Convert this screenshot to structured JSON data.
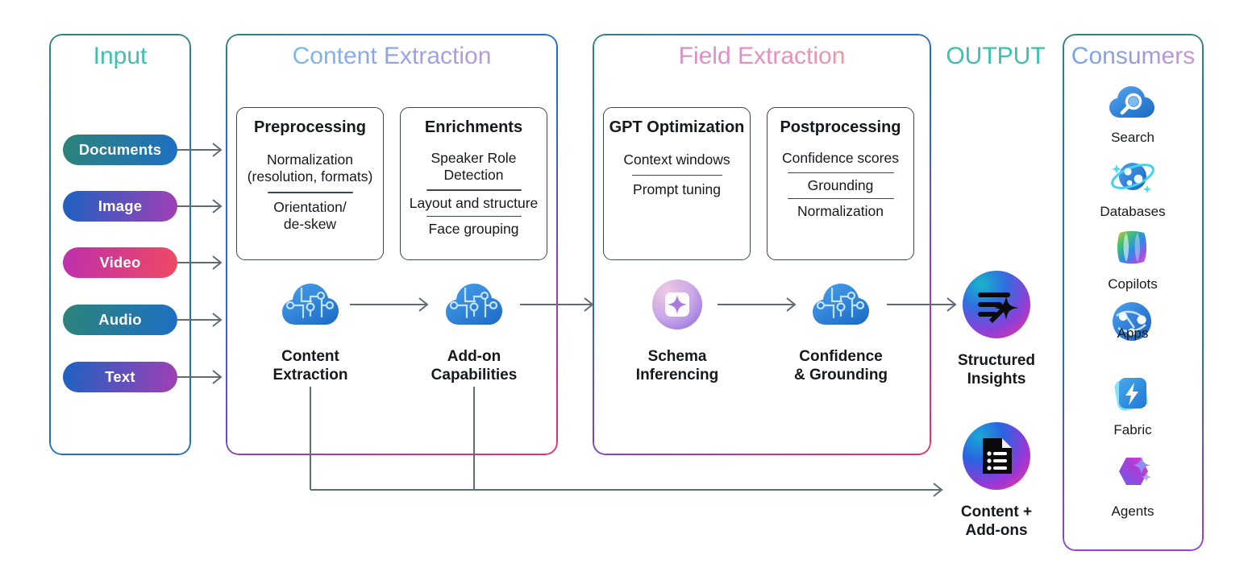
{
  "diagram": {
    "title": "Content Understanding pipeline architecture",
    "sections": {
      "input": {
        "title": "Input",
        "color": "#3fbfb0"
      },
      "content_extraction": {
        "title": "Content Extraction"
      },
      "field_extraction": {
        "title": "Field Extraction"
      },
      "output": {
        "title": "OUTPUT",
        "color": "#3fbfb0"
      },
      "consumers": {
        "title": "Consumers"
      }
    },
    "input_items": [
      {
        "label": "Documents",
        "from": "#2d8479",
        "to": "#1e6fc4"
      },
      {
        "label": "Image",
        "from": "#1b62c2",
        "to": "#a23fb5"
      },
      {
        "label": "Video",
        "from": "#bd2fad",
        "to": "#ef4a62"
      },
      {
        "label": "Audio",
        "from": "#2d8479",
        "to": "#1e6fc4"
      },
      {
        "label": "Text",
        "from": "#1b62c2",
        "to": "#a23fb5"
      }
    ],
    "content_extraction_cards": [
      {
        "heading": "Preprocessing",
        "rows": [
          "Normalization\n(resolution, formats)",
          "Orientation/\nde-skew"
        ]
      },
      {
        "heading": "Enrichments",
        "rows": [
          "Speaker Role\nDetection",
          "Layout and structure",
          "Face grouping"
        ]
      }
    ],
    "field_extraction_cards": [
      {
        "heading": "GPT Optimization",
        "rows": [
          "Context windows",
          "Prompt tuning"
        ]
      },
      {
        "heading": "Postprocessing",
        "rows": [
          "Confidence scores",
          "Grounding",
          "Normalization"
        ]
      }
    ],
    "content_extraction_nodes": [
      {
        "label": "Content\nExtraction",
        "icon": "cloud-circuit-icon"
      },
      {
        "label": "Add-on\nCapabilities",
        "icon": "cloud-circuit-icon"
      }
    ],
    "field_extraction_nodes": [
      {
        "label": "Schema\nInferencing",
        "icon": "sparkle-badge-icon"
      },
      {
        "label": "Confidence\n& Grounding",
        "icon": "cloud-circuit-icon"
      }
    ],
    "output_nodes": [
      {
        "label": "Structured\nInsights",
        "icon": "insights-sparkle-icon"
      },
      {
        "label": "Content +\nAdd-ons",
        "icon": "document-list-icon"
      }
    ],
    "consumers": [
      {
        "label": "Search",
        "icon": "search-cloud-icon"
      },
      {
        "label": "Databases",
        "icon": "cosmos-planet-icon"
      },
      {
        "label": "Copilots",
        "icon": "copilot-ribbon-icon"
      },
      {
        "label": "Apps",
        "icon": "apps-globe-icon"
      },
      {
        "label": "Fabric",
        "icon": "fabric-bolt-icon"
      },
      {
        "label": "Agents",
        "icon": "agents-hexagon-icon"
      }
    ],
    "palette": {
      "teal": "#2d8479",
      "blue": "#1f6fc9",
      "purple": "#8e3fb8",
      "pink": "#e8316b",
      "arrow_gray": "#5f6b75",
      "card_border": "#3b4651",
      "text": "#16191c"
    }
  }
}
